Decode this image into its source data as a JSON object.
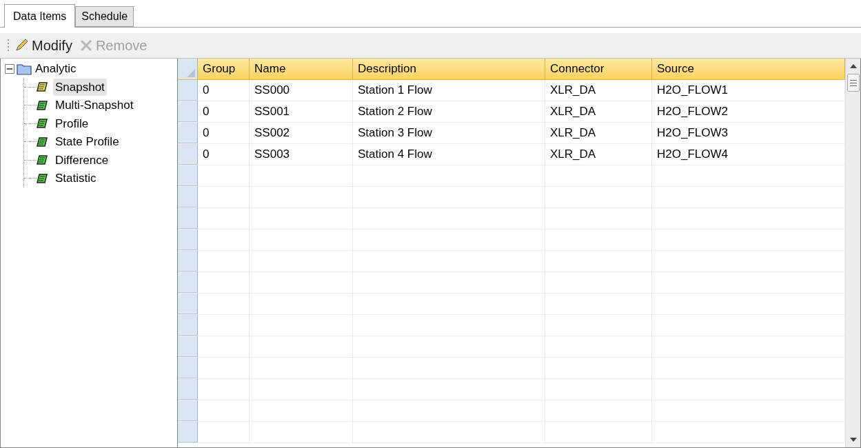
{
  "tabs": [
    {
      "label": "Data Items",
      "selected": true
    },
    {
      "label": "Schedule",
      "selected": false
    }
  ],
  "toolbar": [
    {
      "label": "Modify",
      "kind": "modify",
      "disabled": false
    },
    {
      "label": "Remove",
      "kind": "remove",
      "disabled": true
    }
  ],
  "tree": {
    "label": "Analytic",
    "expanded": true,
    "children": [
      {
        "label": "Snapshot",
        "selected": true
      },
      {
        "label": "Multi-Snapshot",
        "selected": false
      },
      {
        "label": "Profile",
        "selected": false
      },
      {
        "label": "State Profile",
        "selected": false
      },
      {
        "label": "Difference",
        "selected": false
      },
      {
        "label": "Statistic",
        "selected": false
      }
    ]
  },
  "table": {
    "columns": [
      "Group",
      "Name",
      "Description",
      "Connector",
      "Source"
    ],
    "rows": [
      [
        "0",
        "SS000",
        "Station 1 Flow",
        "XLR_DA",
        "H2O_FLOW1"
      ],
      [
        "0",
        "SS001",
        "Station 2 Flow",
        "XLR_DA",
        "H2O_FLOW2"
      ],
      [
        "0",
        "SS002",
        "Station 3 Flow",
        "XLR_DA",
        "H2O_FLOW3"
      ],
      [
        "0",
        "SS003",
        "Station 4 Flow",
        "XLR_DA",
        "H2O_FLOW4"
      ]
    ]
  }
}
